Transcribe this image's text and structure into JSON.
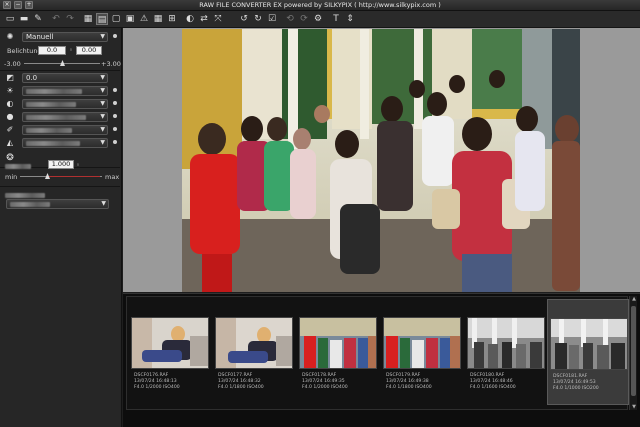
{
  "window": {
    "title": "RAW FILE CONVERTER EX powered by SILKYPIX ( http://www.silkypix.com )",
    "btn_close": "×",
    "btn_min": "−",
    "btn_max": "+"
  },
  "toolbar": {
    "icons": [
      "folder-open-icon",
      "save-icon",
      "eraser-icon",
      "undo-icon",
      "redo-icon",
      "grid-view-icon",
      "filmstrip-view-icon",
      "single-view-icon",
      "fullscreen-icon",
      "warning-icon",
      "navigator-icon",
      "crop-grid-icon",
      "compare-icon",
      "swap-icon",
      "convert-icon",
      "rotate-left-icon",
      "rotate-right-icon",
      "check-icon",
      "develop-icon",
      "batch-icon",
      "settings-icon",
      "text-tool-icon",
      "resize-icon"
    ],
    "glyphs": [
      "▭",
      "▬",
      "✎",
      "↶",
      "↷",
      "▦",
      "▤",
      "▢",
      "▣",
      "⚠",
      "▦",
      "⊞",
      "◐",
      "⇄",
      "⤧",
      "↺",
      "↻",
      "☑",
      "⟲",
      "⟳",
      "⚙",
      "T",
      "⇕"
    ]
  },
  "panel": {
    "wb_preset": "Manuell",
    "belichtung_label": "Belichtung",
    "belichtung_value": "0.0",
    "second_value": "0.00",
    "range_min": "-3.00",
    "range_max": "+3.00",
    "contrast_value": "0.0",
    "sharp_value": "1.000",
    "min_label": "min",
    "max_label": "max"
  },
  "filmstrip": {
    "items": [
      {
        "name": "DSCF0176.RAF",
        "date": "13/07/24 16:48:13",
        "exif": "F4.0 1/2000 ISO400"
      },
      {
        "name": "DSCF0177.RAF",
        "date": "13/07/24 16:48:32",
        "exif": "F4.0 1/1800 ISO400"
      },
      {
        "name": "DSCF0178.RAF",
        "date": "13/07/24 16:49:35",
        "exif": "F4.0 1/2000 ISO400"
      },
      {
        "name": "DSCF0179.RAF",
        "date": "13/07/24 16:49:38",
        "exif": "F4.0 1/1800 ISO400"
      },
      {
        "name": "DSCF0180.RAF",
        "date": "13/07/24 16:48:46",
        "exif": "F4.0 1/1600 ISO400"
      },
      {
        "name": "DSCF0181.RAF",
        "date": "13/07/24 16:49:53",
        "exif": "F4.0 1/1000 ISO200"
      }
    ]
  }
}
